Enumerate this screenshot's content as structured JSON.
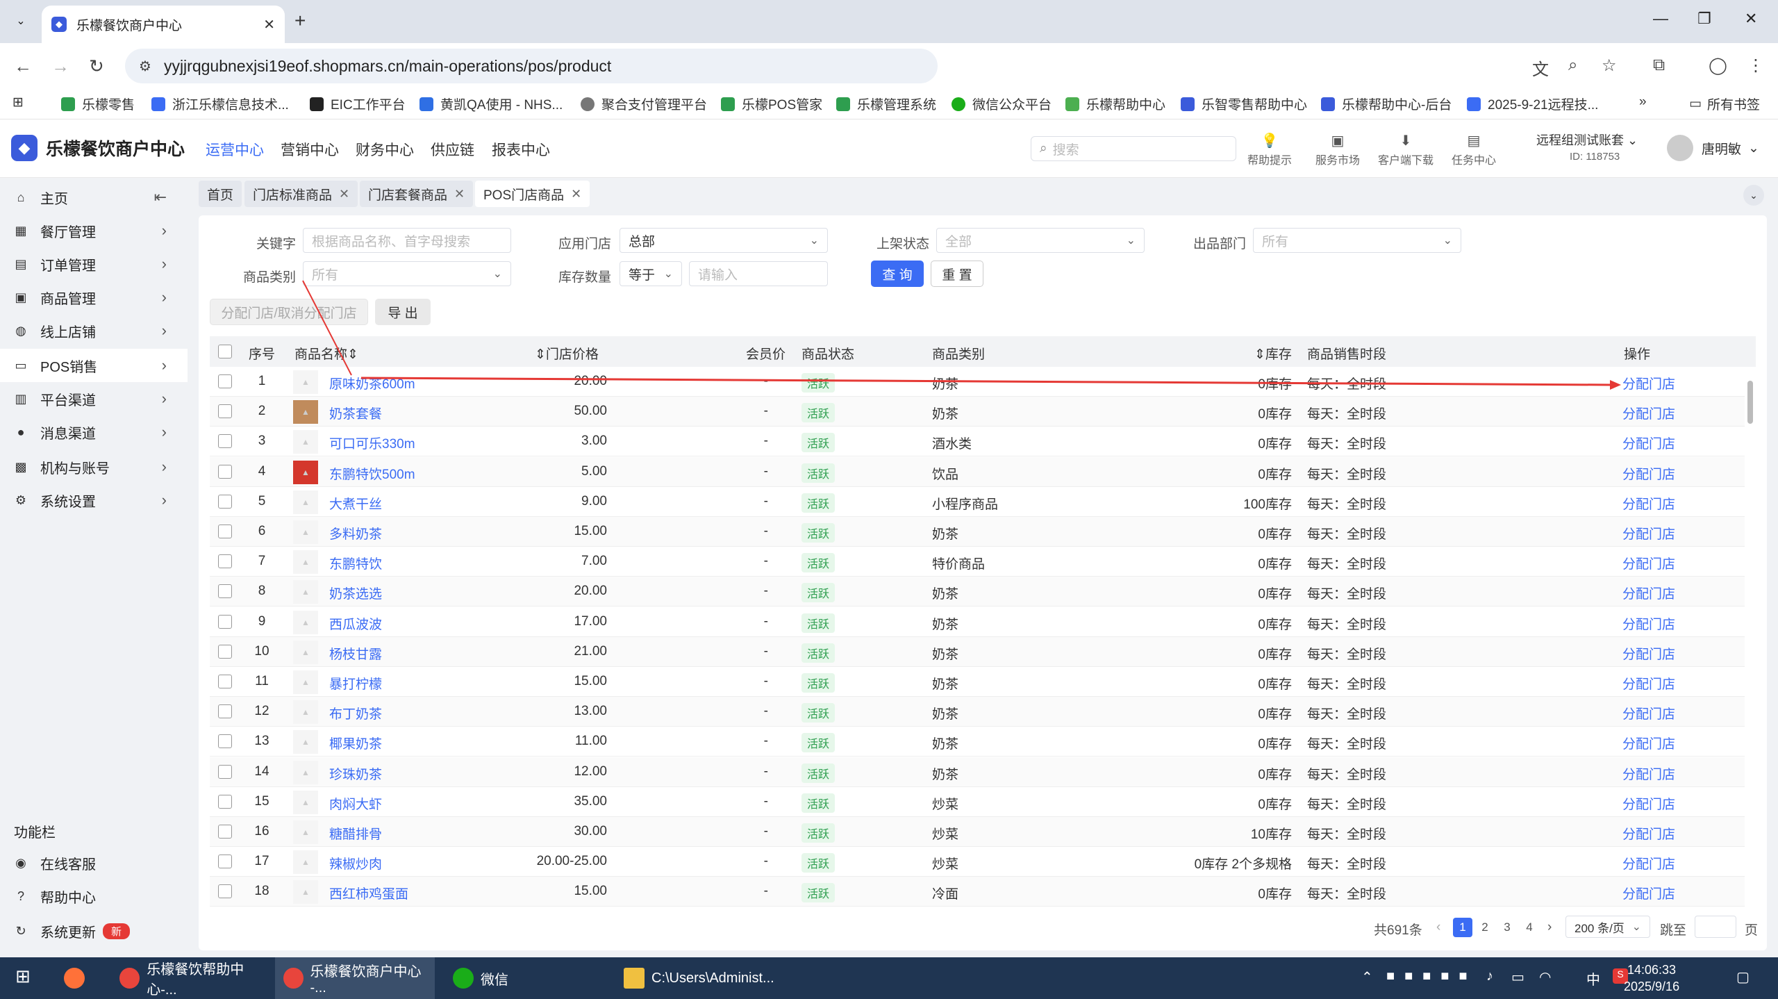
{
  "browser": {
    "tab_title": "乐檬餐饮商户中心",
    "url": "yyjjrqgubnexjsi19eof.shopmars.cn/main-operations/pos/product",
    "bookmarks": [
      "乐檬零售",
      "浙江乐檬信息技术...",
      "EIC工作平台",
      "黄凯QA使用 - NHS...",
      "聚合支付管理平台",
      "乐檬POS管家",
      "乐檬管理系统",
      "微信公众平台",
      "乐檬帮助中心",
      "乐智零售帮助中心",
      "乐檬帮助中心-后台",
      "2025-9-21远程技..."
    ],
    "all_bookmarks": "所有书签"
  },
  "header": {
    "app_name": "乐檬餐饮商户中心",
    "nav": [
      "运营中心",
      "营销中心",
      "财务中心",
      "供应链",
      "报表中心"
    ],
    "search_placeholder": "搜索",
    "tools": [
      "帮助提示",
      "服务市场",
      "客户端下载",
      "任务中心"
    ],
    "account_name": "远程组测试账套",
    "account_id": "ID: 118753",
    "user_name": "唐明敏"
  },
  "sidebar": {
    "items": [
      "主页",
      "餐厅管理",
      "订单管理",
      "商品管理",
      "线上店铺",
      "POS销售",
      "平台渠道",
      "消息渠道",
      "机构与账号",
      "系统设置"
    ],
    "section_label": "功能栏",
    "func_items": [
      "在线客服",
      "帮助中心",
      "系统更新"
    ],
    "new_badge": "新"
  },
  "page_tabs": [
    "首页",
    "门店标准商品",
    "门店套餐商品",
    "POS门店商品"
  ],
  "filters": {
    "keyword_label": "关键字",
    "keyword_placeholder": "根据商品名称、首字母搜索",
    "store_label": "应用门店",
    "store_value": "总部",
    "status_label": "上架状态",
    "status_value": "全部",
    "dept_label": "出品部门",
    "dept_value": "所有",
    "category_label": "商品类别",
    "category_value": "所有",
    "stock_label": "库存数量",
    "stock_op": "等于",
    "stock_placeholder": "请输入",
    "query_button": "查 询",
    "reset_button": "重 置",
    "assign_button": "分配门店/取消分配门店",
    "export_button": "导 出"
  },
  "table": {
    "headers": {
      "seq": "序号",
      "name": "商品名称",
      "price": "门店价格",
      "member": "会员价",
      "status": "商品状态",
      "category": "商品类别",
      "stock": "库存",
      "time": "商品销售时段",
      "op": "操作"
    },
    "rows": [
      {
        "seq": "1",
        "name": "原味奶茶600m",
        "price": "20.00",
        "member": "-",
        "status": "活跃",
        "category": "奶茶",
        "stock": "0库存",
        "time": "每天：全时段",
        "op": "分配门店"
      },
      {
        "seq": "2",
        "name": "奶茶套餐",
        "price": "50.00",
        "member": "-",
        "status": "活跃",
        "category": "奶茶",
        "stock": "0库存",
        "time": "每天：全时段",
        "op": "分配门店"
      },
      {
        "seq": "3",
        "name": "可口可乐330m",
        "price": "3.00",
        "member": "-",
        "status": "活跃",
        "category": "酒水类",
        "stock": "0库存",
        "time": "每天：全时段",
        "op": "分配门店"
      },
      {
        "seq": "4",
        "name": "东鹏特饮500m",
        "price": "5.00",
        "member": "-",
        "status": "活跃",
        "category": "饮品",
        "stock": "0库存",
        "time": "每天：全时段",
        "op": "分配门店"
      },
      {
        "seq": "5",
        "name": "大煮干丝",
        "price": "9.00",
        "member": "-",
        "status": "活跃",
        "category": "小程序商品",
        "stock": "100库存",
        "time": "每天：全时段",
        "op": "分配门店"
      },
      {
        "seq": "6",
        "name": "多料奶茶",
        "price": "15.00",
        "member": "-",
        "status": "活跃",
        "category": "奶茶",
        "stock": "0库存",
        "time": "每天：全时段",
        "op": "分配门店"
      },
      {
        "seq": "7",
        "name": "东鹏特饮",
        "price": "7.00",
        "member": "-",
        "status": "活跃",
        "category": "特价商品",
        "stock": "0库存",
        "time": "每天：全时段",
        "op": "分配门店"
      },
      {
        "seq": "8",
        "name": "奶茶选选",
        "price": "20.00",
        "member": "-",
        "status": "活跃",
        "category": "奶茶",
        "stock": "0库存",
        "time": "每天：全时段",
        "op": "分配门店"
      },
      {
        "seq": "9",
        "name": "西瓜波波",
        "price": "17.00",
        "member": "-",
        "status": "活跃",
        "category": "奶茶",
        "stock": "0库存",
        "time": "每天：全时段",
        "op": "分配门店"
      },
      {
        "seq": "10",
        "name": "杨枝甘露",
        "price": "21.00",
        "member": "-",
        "status": "活跃",
        "category": "奶茶",
        "stock": "0库存",
        "time": "每天：全时段",
        "op": "分配门店"
      },
      {
        "seq": "11",
        "name": "暴打柠檬",
        "price": "15.00",
        "member": "-",
        "status": "活跃",
        "category": "奶茶",
        "stock": "0库存",
        "time": "每天：全时段",
        "op": "分配门店"
      },
      {
        "seq": "12",
        "name": "布丁奶茶",
        "price": "13.00",
        "member": "-",
        "status": "活跃",
        "category": "奶茶",
        "stock": "0库存",
        "time": "每天：全时段",
        "op": "分配门店"
      },
      {
        "seq": "13",
        "name": "椰果奶茶",
        "price": "11.00",
        "member": "-",
        "status": "活跃",
        "category": "奶茶",
        "stock": "0库存",
        "time": "每天：全时段",
        "op": "分配门店"
      },
      {
        "seq": "14",
        "name": "珍珠奶茶",
        "price": "12.00",
        "member": "-",
        "status": "活跃",
        "category": "奶茶",
        "stock": "0库存",
        "time": "每天：全时段",
        "op": "分配门店"
      },
      {
        "seq": "15",
        "name": "肉焖大虾",
        "price": "35.00",
        "member": "-",
        "status": "活跃",
        "category": "炒菜",
        "stock": "0库存",
        "time": "每天：全时段",
        "op": "分配门店"
      },
      {
        "seq": "16",
        "name": "糖醋排骨",
        "price": "30.00",
        "member": "-",
        "status": "活跃",
        "category": "炒菜",
        "stock": "10库存",
        "time": "每天：全时段",
        "op": "分配门店"
      },
      {
        "seq": "17",
        "name": "辣椒炒肉",
        "price": "20.00-25.00",
        "member": "-",
        "status": "活跃",
        "category": "炒菜",
        "stock": "0库存 2个多规格",
        "time": "每天：全时段",
        "op": "分配门店"
      },
      {
        "seq": "18",
        "name": "西红柿鸡蛋面",
        "price": "15.00",
        "member": "-",
        "status": "活跃",
        "category": "冷面",
        "stock": "0库存",
        "time": "每天：全时段",
        "op": "分配门店"
      }
    ]
  },
  "pagination": {
    "total": "共691条",
    "pages": [
      "1",
      "2",
      "3",
      "4"
    ],
    "page_size": "200 条/页",
    "jump_label": "跳至",
    "page_unit": "页"
  },
  "taskbar": {
    "items": [
      "乐檬餐饮帮助中心-...",
      "乐檬餐饮商户中心 -...",
      "微信",
      "C:\\Users\\Administ..."
    ],
    "ime": "中",
    "time": "14:06:33",
    "date": "2025/9/16"
  }
}
